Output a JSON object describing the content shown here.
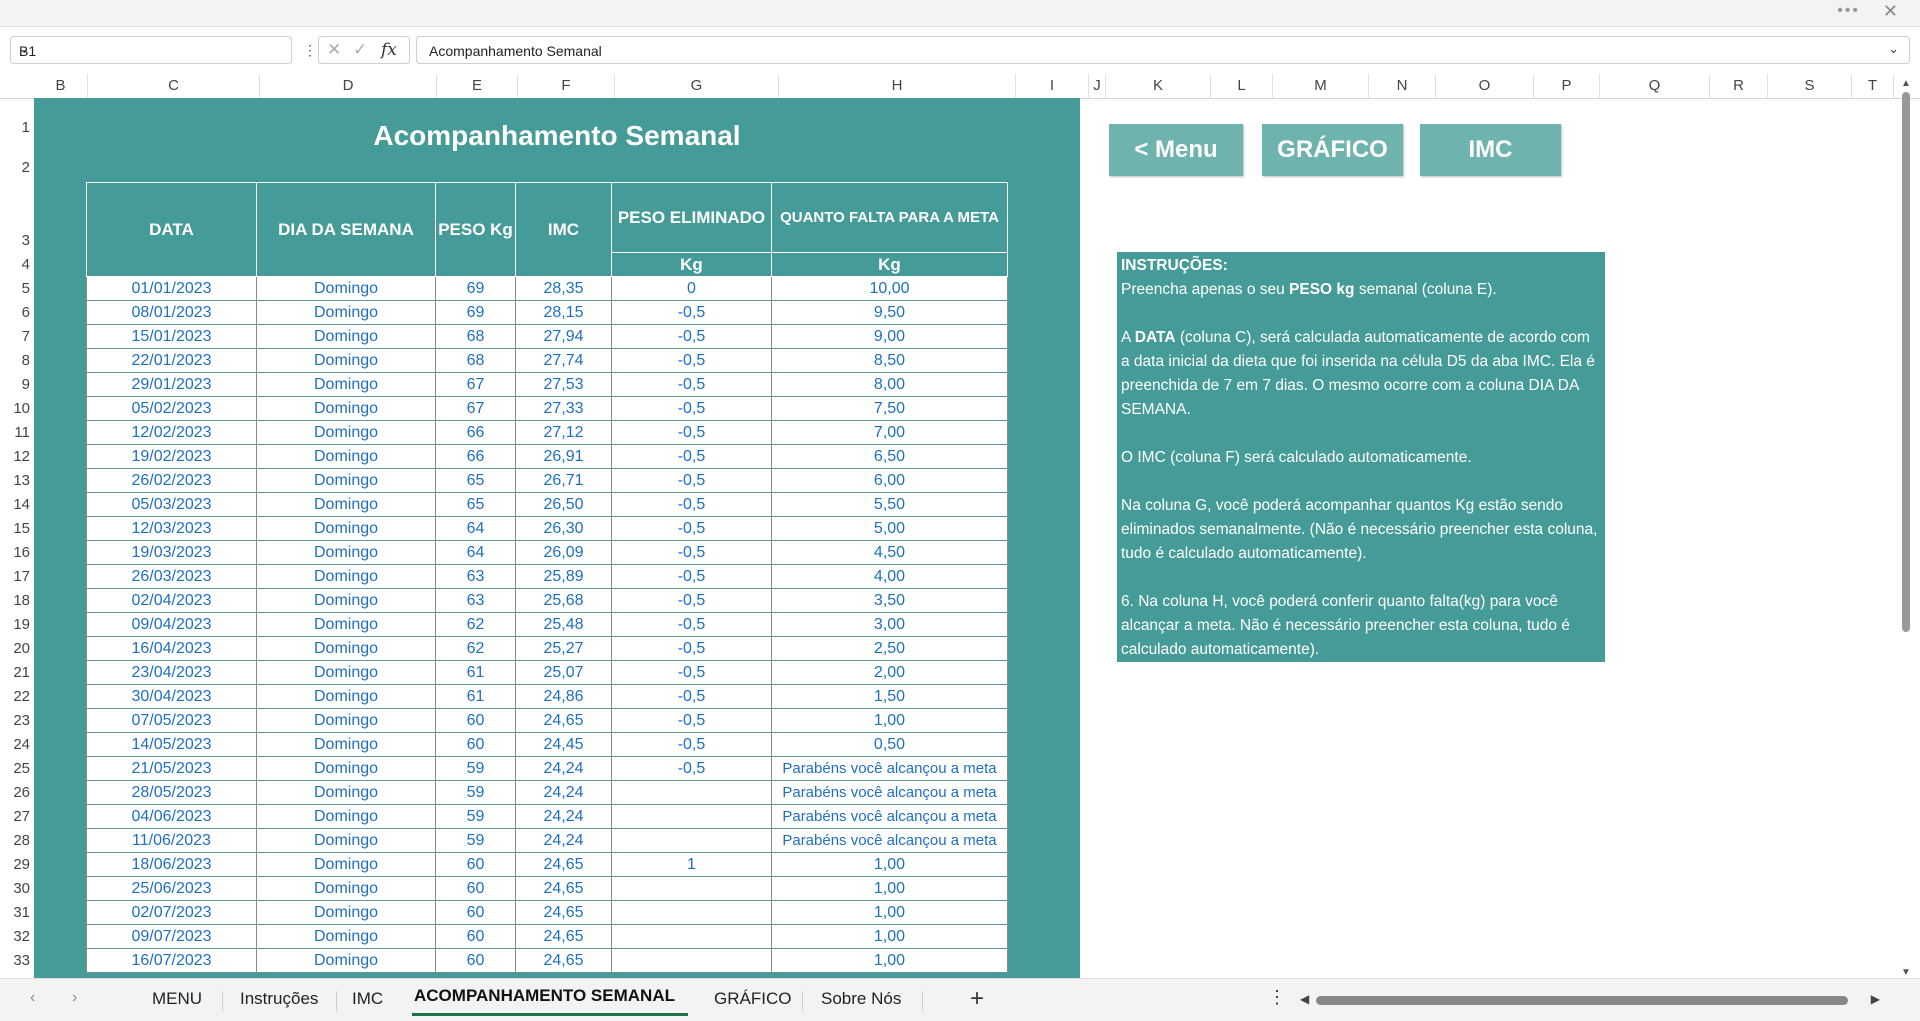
{
  "window": {
    "more_icon": "ellipsis-icon",
    "close_glyph": "✕"
  },
  "formula_bar": {
    "name_box": "B1",
    "formula": "Acompanhamento Semanal",
    "fx_label": "fx"
  },
  "columns": [
    "B",
    "C",
    "D",
    "E",
    "F",
    "G",
    "H",
    "I",
    "J",
    "K",
    "L",
    "M",
    "N",
    "O",
    "P",
    "Q",
    "R",
    "S",
    "T"
  ],
  "rows": [
    "1",
    "2",
    "3",
    "4",
    "5",
    "6",
    "7",
    "8",
    "9",
    "10",
    "11",
    "12",
    "13",
    "14",
    "15",
    "16",
    "17",
    "18",
    "19",
    "20",
    "21",
    "22",
    "23",
    "24",
    "25",
    "26",
    "27",
    "28",
    "29",
    "30",
    "31",
    "32",
    "33"
  ],
  "sheet": {
    "title": "Acompanhamento Semanal",
    "headers": {
      "data": "DATA",
      "dia": "DIA DA SEMANA",
      "peso": "PESO Kg",
      "imc": "IMC",
      "eliminado": "PESO ELIMINADO",
      "falta": "QUANTO FALTA PARA A META",
      "eliminado_unit": "Kg",
      "falta_unit": "Kg"
    },
    "table": [
      [
        "01/01/2023",
        "Domingo",
        "69",
        "28,35",
        "0",
        "10,00"
      ],
      [
        "08/01/2023",
        "Domingo",
        "69",
        "28,15",
        "-0,5",
        "9,50"
      ],
      [
        "15/01/2023",
        "Domingo",
        "68",
        "27,94",
        "-0,5",
        "9,00"
      ],
      [
        "22/01/2023",
        "Domingo",
        "68",
        "27,74",
        "-0,5",
        "8,50"
      ],
      [
        "29/01/2023",
        "Domingo",
        "67",
        "27,53",
        "-0,5",
        "8,00"
      ],
      [
        "05/02/2023",
        "Domingo",
        "67",
        "27,33",
        "-0,5",
        "7,50"
      ],
      [
        "12/02/2023",
        "Domingo",
        "66",
        "27,12",
        "-0,5",
        "7,00"
      ],
      [
        "19/02/2023",
        "Domingo",
        "66",
        "26,91",
        "-0,5",
        "6,50"
      ],
      [
        "26/02/2023",
        "Domingo",
        "65",
        "26,71",
        "-0,5",
        "6,00"
      ],
      [
        "05/03/2023",
        "Domingo",
        "65",
        "26,50",
        "-0,5",
        "5,50"
      ],
      [
        "12/03/2023",
        "Domingo",
        "64",
        "26,30",
        "-0,5",
        "5,00"
      ],
      [
        "19/03/2023",
        "Domingo",
        "64",
        "26,09",
        "-0,5",
        "4,50"
      ],
      [
        "26/03/2023",
        "Domingo",
        "63",
        "25,89",
        "-0,5",
        "4,00"
      ],
      [
        "02/04/2023",
        "Domingo",
        "63",
        "25,68",
        "-0,5",
        "3,50"
      ],
      [
        "09/04/2023",
        "Domingo",
        "62",
        "25,48",
        "-0,5",
        "3,00"
      ],
      [
        "16/04/2023",
        "Domingo",
        "62",
        "25,27",
        "-0,5",
        "2,50"
      ],
      [
        "23/04/2023",
        "Domingo",
        "61",
        "25,07",
        "-0,5",
        "2,00"
      ],
      [
        "30/04/2023",
        "Domingo",
        "61",
        "24,86",
        "-0,5",
        "1,50"
      ],
      [
        "07/05/2023",
        "Domingo",
        "60",
        "24,65",
        "-0,5",
        "1,00"
      ],
      [
        "14/05/2023",
        "Domingo",
        "60",
        "24,45",
        "-0,5",
        "0,50"
      ],
      [
        "21/05/2023",
        "Domingo",
        "59",
        "24,24",
        "-0,5",
        "Parabéns você alcançou a meta"
      ],
      [
        "28/05/2023",
        "Domingo",
        "59",
        "24,24",
        "",
        "Parabéns você alcançou a meta"
      ],
      [
        "04/06/2023",
        "Domingo",
        "59",
        "24,24",
        "",
        "Parabéns você alcançou a meta"
      ],
      [
        "11/06/2023",
        "Domingo",
        "59",
        "24,24",
        "",
        "Parabéns você alcançou a meta"
      ],
      [
        "18/06/2023",
        "Domingo",
        "60",
        "24,65",
        "1",
        "1,00"
      ],
      [
        "25/06/2023",
        "Domingo",
        "60",
        "24,65",
        "",
        "1,00"
      ],
      [
        "02/07/2023",
        "Domingo",
        "60",
        "24,65",
        "",
        "1,00"
      ],
      [
        "09/07/2023",
        "Domingo",
        "60",
        "24,65",
        "",
        "1,00"
      ],
      [
        "16/07/2023",
        "Domingo",
        "60",
        "24,65",
        "",
        "1,00"
      ]
    ],
    "buttons": {
      "menu": "< Menu",
      "grafico": "GRÁFICO",
      "imc": "IMC"
    },
    "instructions": {
      "heading": "INSTRUÇÕES:",
      "p1_before": "Preencha apenas o seu ",
      "p1_bold": "PESO kg",
      "p1_after": " semanal (coluna E).",
      "p2_before": "A ",
      "p2_bold": "DATA",
      "p2_after": " (coluna C), será calculada automaticamente de acordo com a data inicial da dieta que foi inserida na célula D5 da aba IMC. Ela é preenchida de 7 em 7 dias. O mesmo ocorre com a coluna DIA DA SEMANA.",
      "p3": "O IMC (coluna F) será calculado automaticamente.",
      "p4": "Na coluna G, você poderá acompanhar quantos Kg estão sendo eliminados semanalmente. (Não é necessário preencher esta coluna, tudo é calculado automaticamente).",
      "p5": "6. Na coluna H, você poderá conferir quanto falta(kg) para você alcançar a meta. Não é necessário preencher esta coluna, tudo é calculado automaticamente)."
    }
  },
  "tabs": [
    "MENU",
    "Instruções",
    "IMC",
    "ACOMPANHAMENTO SEMANAL",
    "GRÁFICO",
    "Sobre Nós"
  ],
  "active_tab": "ACOMPANHAMENTO SEMANAL",
  "colors": {
    "teal": "#459b98",
    "button": "#6fb3ae",
    "cell_text": "#1f6fc0",
    "active_tab_underline": "#1e7145"
  }
}
